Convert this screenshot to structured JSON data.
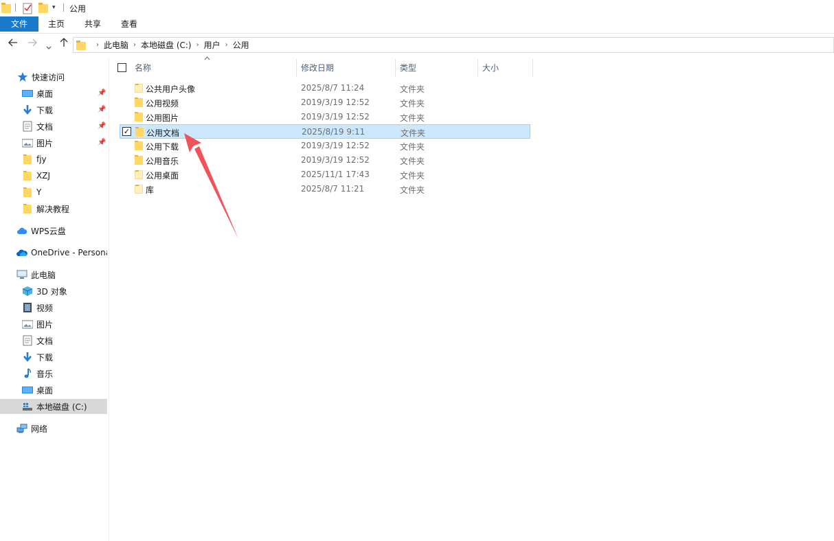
{
  "window": {
    "title": "公用"
  },
  "ribbon": {
    "tabs": [
      "文件",
      "主页",
      "共享",
      "查看"
    ]
  },
  "address": {
    "crumbs": [
      "此电脑",
      "本地磁盘 (C:)",
      "用户",
      "公用"
    ]
  },
  "sidebar": {
    "quick_access": "快速访问",
    "quick_items": [
      "桌面",
      "下载",
      "文档",
      "图片",
      "fjy",
      "XZJ",
      "Y",
      "解决教程"
    ],
    "wps": "WPS云盘",
    "onedrive": "OneDrive - Persona",
    "this_pc": "此电脑",
    "pc_items": [
      "3D 对象",
      "视频",
      "图片",
      "文档",
      "下载",
      "音乐",
      "桌面",
      "本地磁盘 (C:)"
    ],
    "network": "网络"
  },
  "columns": {
    "name": "名称",
    "date": "修改日期",
    "type": "类型",
    "size": "大小"
  },
  "files": [
    {
      "name": "公共用户头像",
      "date": "2025/8/7 11:24",
      "type": "文件夹"
    },
    {
      "name": "公用视频",
      "date": "2019/3/19 12:52",
      "type": "文件夹"
    },
    {
      "name": "公用图片",
      "date": "2019/3/19 12:52",
      "type": "文件夹"
    },
    {
      "name": "公用文档",
      "date": "2025/8/19 9:11",
      "type": "文件夹"
    },
    {
      "name": "公用下载",
      "date": "2019/3/19 12:52",
      "type": "文件夹"
    },
    {
      "name": "公用音乐",
      "date": "2019/3/19 12:52",
      "type": "文件夹"
    },
    {
      "name": "公用桌面",
      "date": "2025/11/1 17:43",
      "type": "文件夹"
    },
    {
      "name": "库",
      "date": "2025/8/7 11:21",
      "type": "文件夹"
    }
  ],
  "colors": {
    "accent": "#1979ca",
    "selection": "#cce8ff",
    "annotation_arrow": "#f0545a"
  }
}
